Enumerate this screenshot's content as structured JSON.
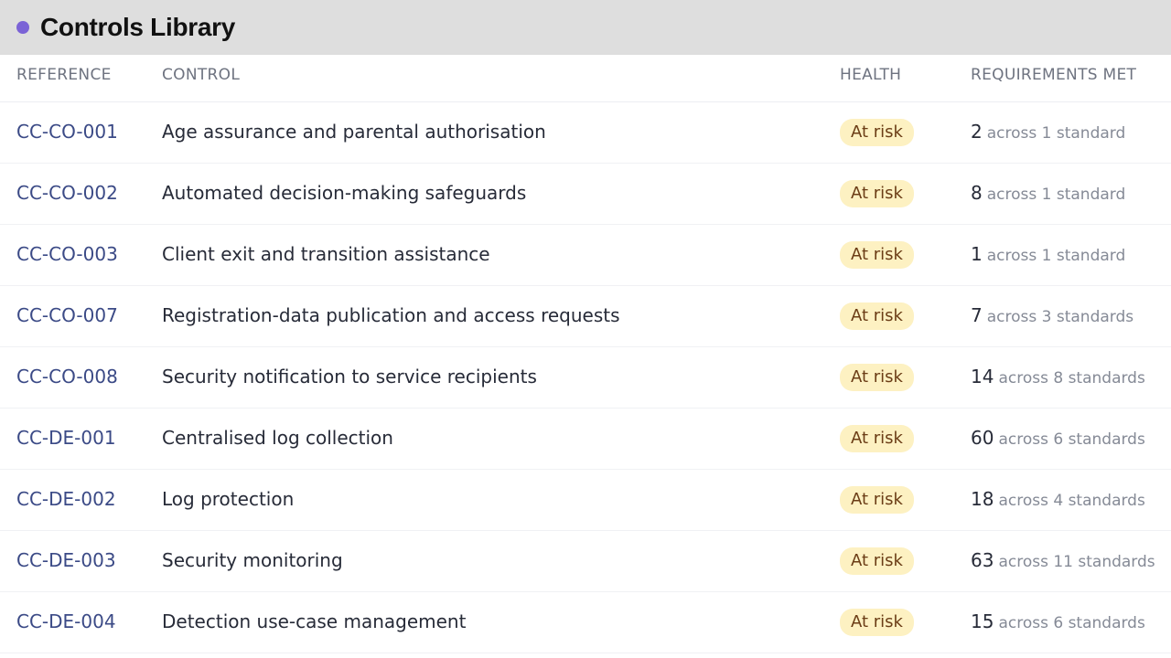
{
  "window": {
    "title": "Controls Library",
    "accent": "#7b63d6"
  },
  "table": {
    "columns": {
      "reference": "REFERENCE",
      "control": "CONTROL",
      "health": "HEALTH",
      "requirements": "REQUIREMENTS MET"
    },
    "rows": [
      {
        "ref": "CC-CO-001",
        "control": "Age assurance and parental authorisation",
        "health": "At risk",
        "count": "2",
        "across": "across 1 standard"
      },
      {
        "ref": "CC-CO-002",
        "control": "Automated decision-making safeguards",
        "health": "At risk",
        "count": "8",
        "across": "across 1 standard"
      },
      {
        "ref": "CC-CO-003",
        "control": "Client exit and transition assistance",
        "health": "At risk",
        "count": "1",
        "across": "across 1 standard"
      },
      {
        "ref": "CC-CO-007",
        "control": "Registration-data publication and access requests",
        "health": "At risk",
        "count": "7",
        "across": "across 3 standards"
      },
      {
        "ref": "CC-CO-008",
        "control": "Security notification to service recipients",
        "health": "At risk",
        "count": "14",
        "across": "across 8 standards"
      },
      {
        "ref": "CC-DE-001",
        "control": "Centralised log collection",
        "health": "At risk",
        "count": "60",
        "across": "across 6 standards"
      },
      {
        "ref": "CC-DE-002",
        "control": "Log protection",
        "health": "At risk",
        "count": "18",
        "across": "across 4 standards"
      },
      {
        "ref": "CC-DE-003",
        "control": "Security monitoring",
        "health": "At risk",
        "count": "63",
        "across": "across 11 standards"
      },
      {
        "ref": "CC-DE-004",
        "control": "Detection use-case management",
        "health": "At risk",
        "count": "15",
        "across": "across 6 standards"
      }
    ]
  }
}
